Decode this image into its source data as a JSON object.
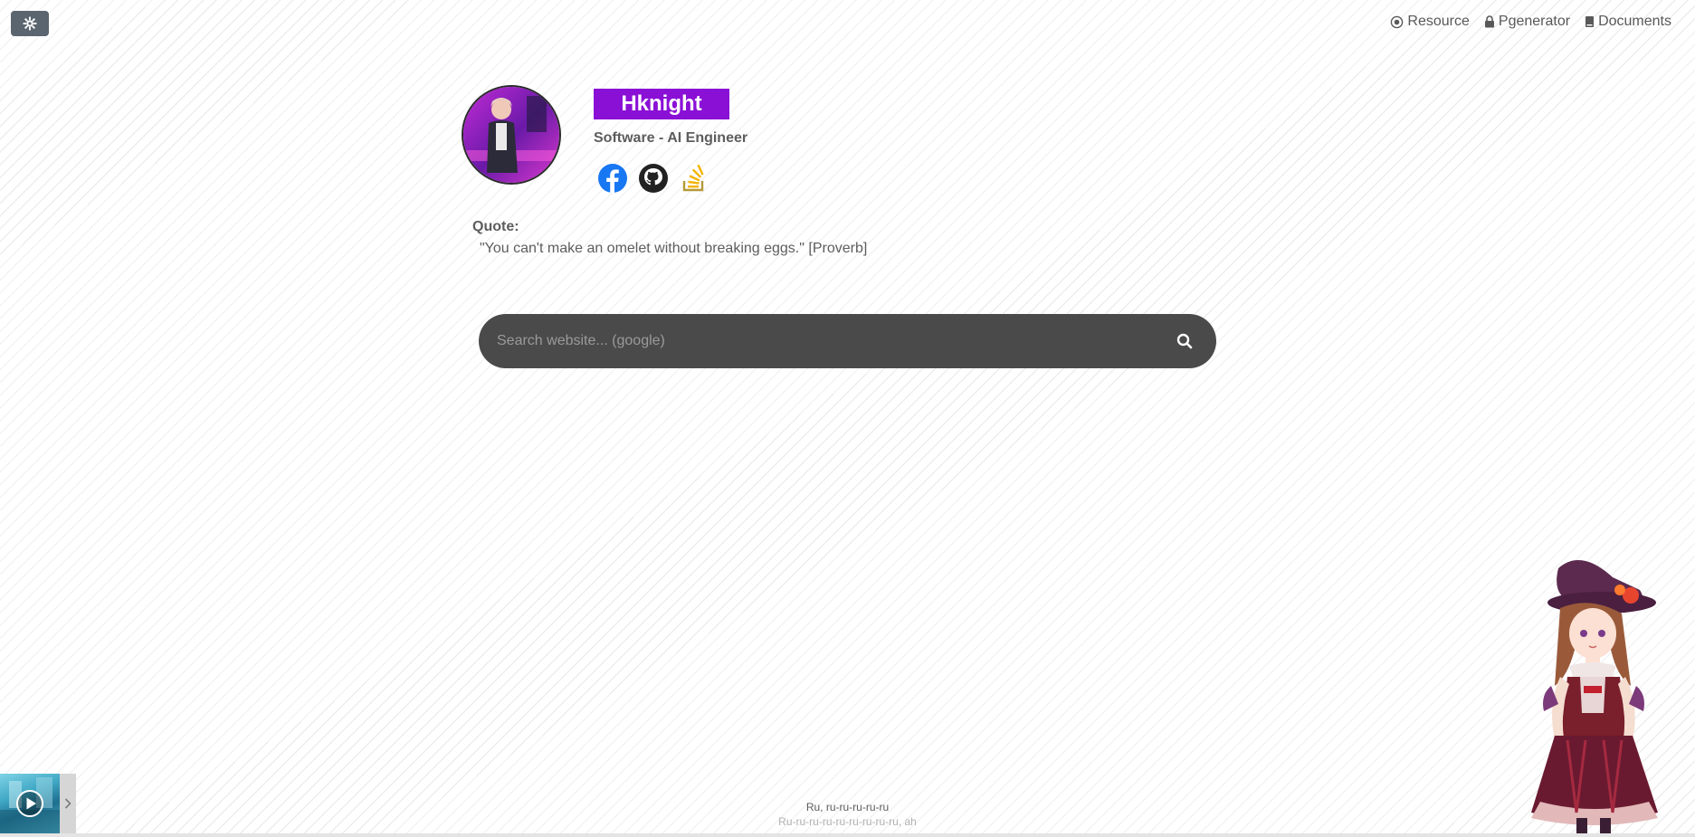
{
  "nav": {
    "links": [
      {
        "label": "Resource",
        "icon": "radio-target-icon"
      },
      {
        "label": "Pgenerator",
        "icon": "lock-icon"
      },
      {
        "label": "Documents",
        "icon": "book-icon"
      }
    ]
  },
  "theme_toggle": {
    "icon": "gear-icon"
  },
  "profile": {
    "name": "Hknight",
    "role": "Software - AI Engineer",
    "socials": [
      {
        "name": "facebook-icon",
        "color": "#1877f2"
      },
      {
        "name": "github-icon",
        "color": "#222222"
      },
      {
        "name": "stackoverflow-icon",
        "color": "#f4b400"
      }
    ],
    "name_bg": "#8a10d6"
  },
  "quote": {
    "label": "Quote:",
    "text": "\"You can't make an omelet without breaking eggs.\" [Proverb]"
  },
  "search": {
    "placeholder": "Search website... (google)",
    "icon": "search-icon"
  },
  "player": {
    "lyric_current": "Ru, ru-ru-ru-ru-ru",
    "lyric_next": "Ru-ru-ru-ru-ru-ru-ru-ru-ru, ah",
    "play_icon": "play-icon",
    "toggle_icon": "chevron-right-icon"
  }
}
